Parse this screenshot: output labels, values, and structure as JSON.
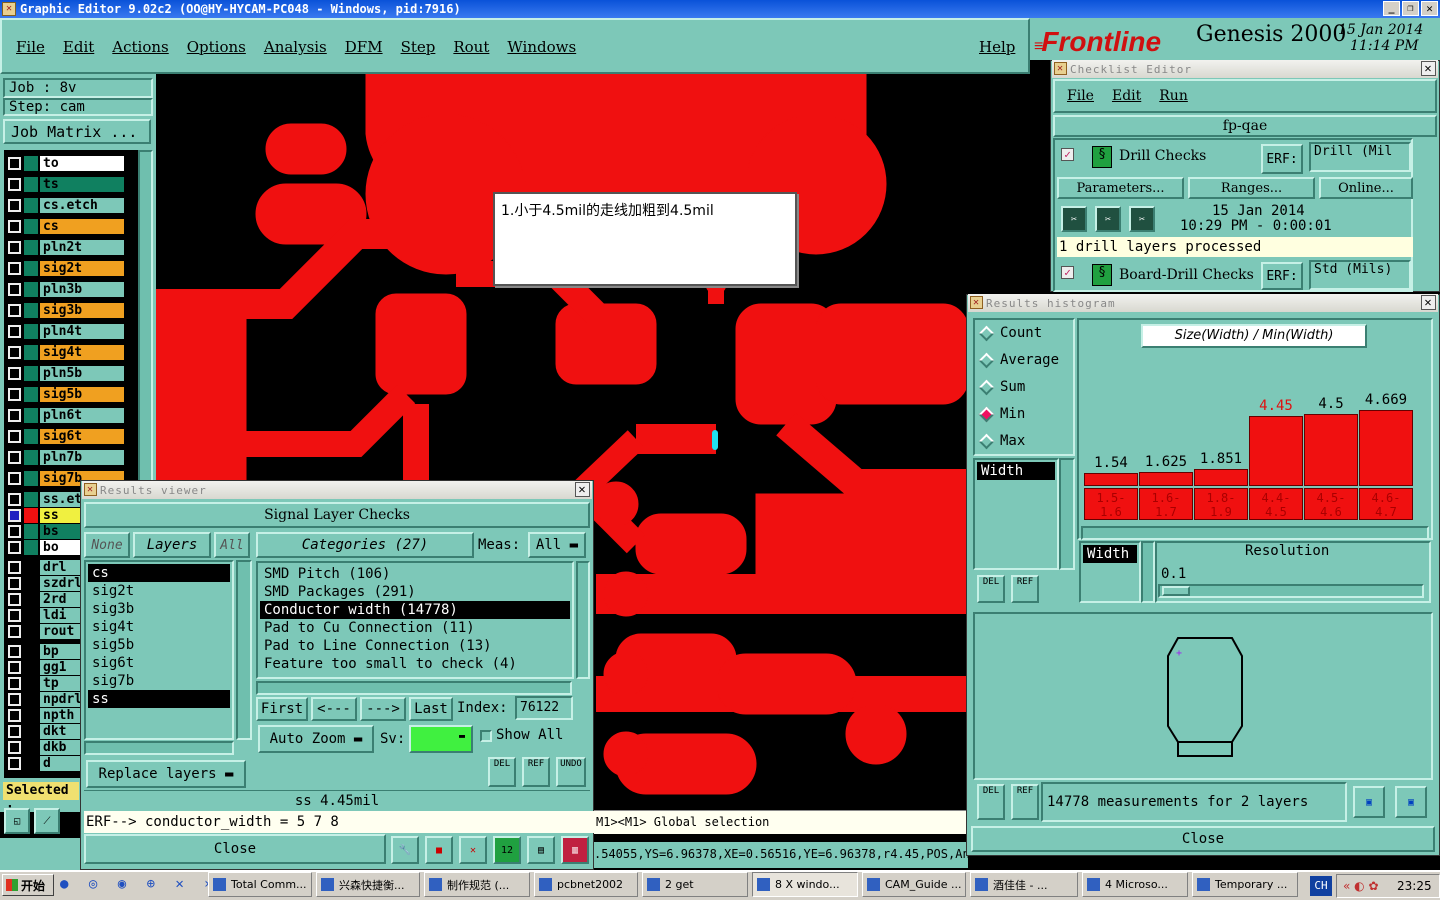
{
  "window": {
    "title": "Graphic Editor 9.02c2  (OO@HY-HYCAM-PC048 - Windows, pid:7916)"
  },
  "menu": [
    "File",
    "Edit",
    "Actions",
    "Options",
    "Analysis",
    "DFM",
    "Step",
    "Rout",
    "Windows"
  ],
  "help": "Help",
  "brand": {
    "logo": "Frontline",
    "product": "Genesis 2000",
    "date": "15 Jan 2014",
    "time": "11:14 PM"
  },
  "job": {
    "job": "Job : 8v",
    "step": "Step: cam",
    "matrix": "Job Matrix ..."
  },
  "layers_top": [
    "to",
    "ts",
    "cs.etch",
    "cs",
    "pln2t",
    "sig2t",
    "pln3b",
    "sig3b",
    "pln4t",
    "sig4t",
    "pln5b",
    "sig5b",
    "pln6t",
    "sig6t",
    "pln7b",
    "sig7b",
    "ss.et"
  ],
  "layers_mid": [
    "ss",
    "bs",
    "bo"
  ],
  "layers_drill": [
    "drl",
    "szdrl",
    "2rd",
    "ldi",
    "rout"
  ],
  "layers_bottom": [
    "bp",
    "gg1",
    "tp",
    "npdrl",
    "npth",
    "dkt",
    "dkb",
    "d"
  ],
  "selected_label": "Selected :",
  "note": "1.小于4.5mil的走线加粗到4.5mil",
  "checklist": {
    "title": "Checklist Editor",
    "menu": [
      "File",
      "Edit",
      "Run"
    ],
    "name": "fp-qae",
    "check1": "Drill Checks",
    "erf": "ERF:",
    "check1_erf": "Drill (Mil",
    "params": "Parameters...",
    "ranges": "Ranges...",
    "online": "Online...",
    "date": "15 Jan 2014",
    "time": "10:29 PM - 0:00:01",
    "status": "1 drill layers processed",
    "check2": "Board-Drill Checks",
    "check2_erf": "Std (Mils)"
  },
  "histogram": {
    "title": "Results histogram",
    "modes": [
      "Count",
      "Average",
      "Sum",
      "Min",
      "Max"
    ],
    "selected_mode": "Min",
    "field": "Width",
    "field2": "Width",
    "header": "Size(Width) / Min(Width)",
    "resolution_label": "Resolution",
    "resolution": "0.1",
    "del": "DEL",
    "ref": "REF",
    "summary": "14778 measurements for 2 layers",
    "close": "Close"
  },
  "chart_data": {
    "type": "bar",
    "categories": [
      "1.5-1.6",
      "1.6-1.7",
      "1.8-1.9",
      "4.4-4.5",
      "4.5-4.6",
      "4.6-4.7"
    ],
    "values": [
      1.54,
      1.625,
      1.851,
      4.45,
      4.5,
      4.669
    ],
    "labels": [
      "1.54",
      "1.625",
      "1.851",
      "4.45",
      "4.5",
      "4.669"
    ],
    "highlight_index": 3,
    "title": "Size(Width) / Min(Width)"
  },
  "results": {
    "title": "Results viewer",
    "header": "Signal Layer Checks",
    "none": "None",
    "layers": "Layers",
    "all": "All",
    "layer_list": [
      "cs",
      "sig2t",
      "sig3b",
      "sig4t",
      "sig5b",
      "sig6t",
      "sig7b",
      "ss"
    ],
    "categories_btn": "Categories (27)",
    "meas": "Meas:",
    "meas_val": "All",
    "categories": [
      "SMD Pitch (106)",
      "SMD Packages (291)",
      "Conductor width (14778)",
      "Pad to Cu Connection (11)",
      "Pad to Line Connection (13)",
      "Feature too small to check (4)"
    ],
    "first": "First",
    "prev": "<---",
    "next": "--->",
    "last": "Last",
    "index_label": "Index:",
    "index": "76122",
    "auto_zoom": "Auto Zoom",
    "sv": "Sv:",
    "show_all": "Show All",
    "replace": "Replace layers",
    "del": "DEL",
    "ref": "REF",
    "undo": "UNDO",
    "status": "ss 4.45mil",
    "erf_line": "ERF--> conductor_width = 5 7 8",
    "close": "Close"
  },
  "status": {
    "msg": "M1><M1> Global selection",
    "coords": ".54055,YS=6.96378,XE=0.56516,YE=6.96378,r4.45,POS,Ang"
  },
  "taskbar": {
    "start": "开始",
    "items": [
      "Total Comm...",
      "兴森快捷衡...",
      "制作规范 (...",
      "pcbnet2002",
      "2 get",
      "8 X windo...",
      "CAM_Guide ...",
      "酒佳佳 - ...",
      "4 Microso...",
      "Temporary ..."
    ],
    "lang": "CH",
    "clock": "23:25"
  }
}
